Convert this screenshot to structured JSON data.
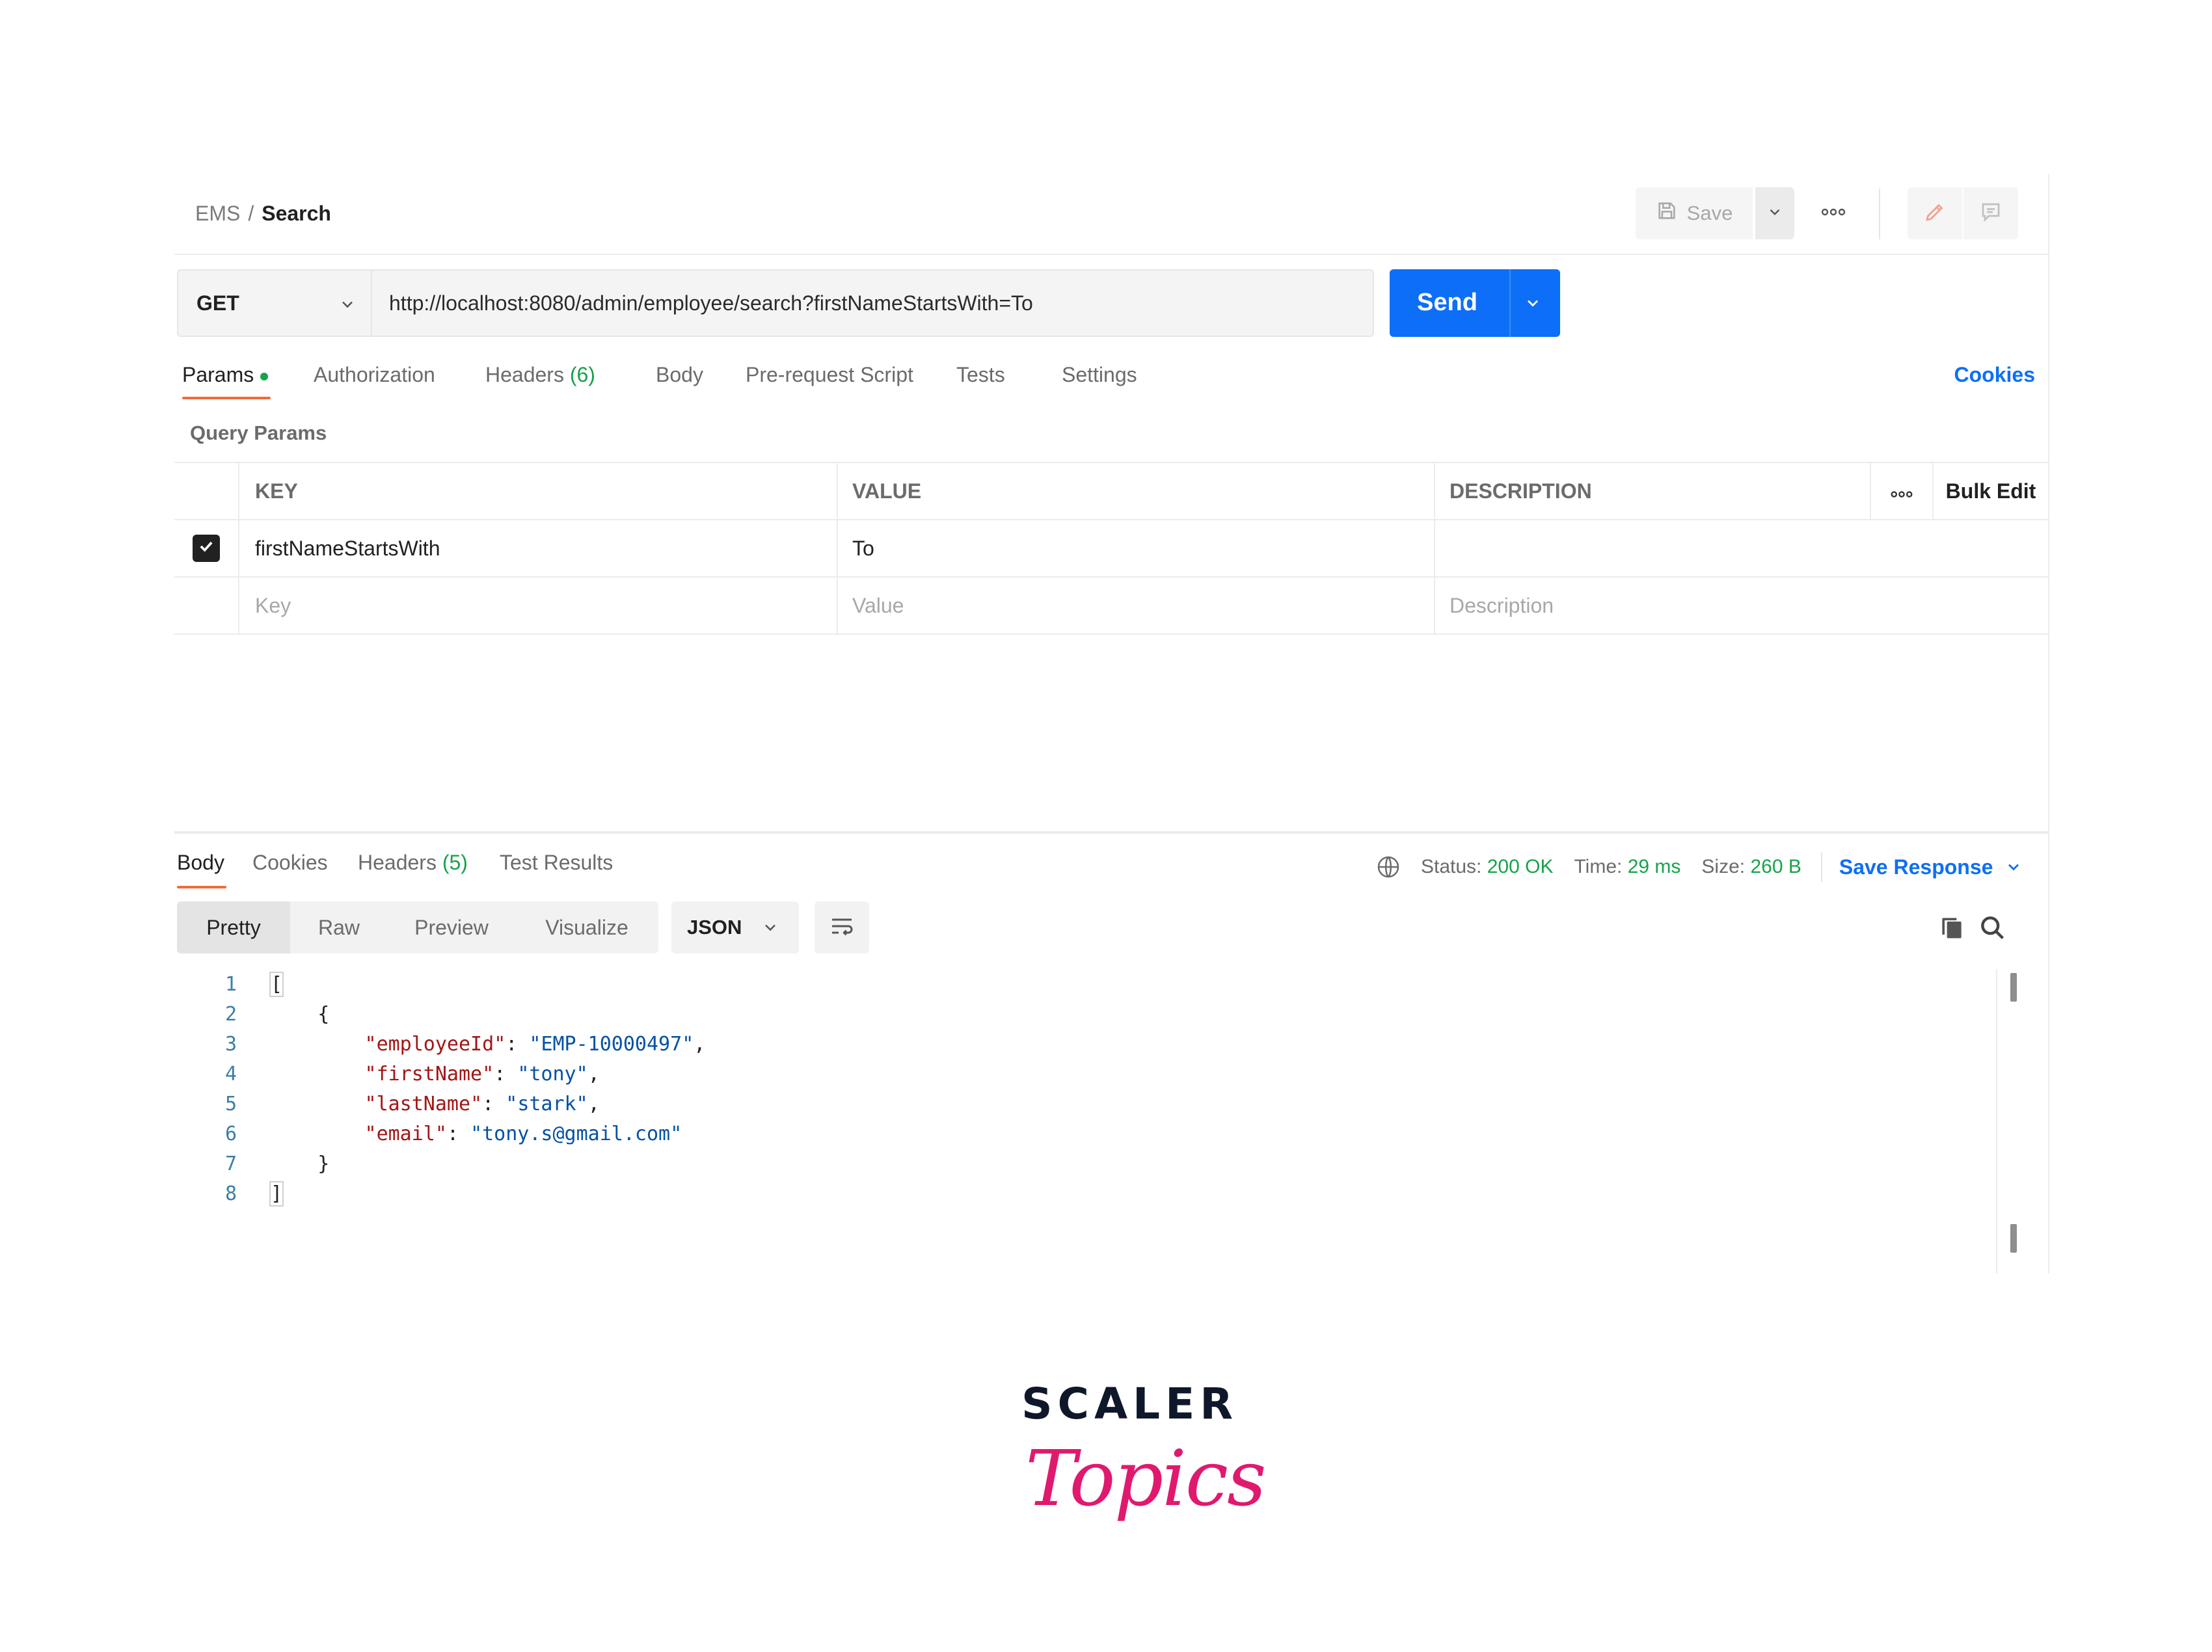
{
  "header": {
    "breadcrumb_parent": "EMS",
    "breadcrumb_sep": "/",
    "breadcrumb_current": "Search",
    "save_label": "Save"
  },
  "request": {
    "method": "GET",
    "url": "http://localhost:8080/admin/employee/search?firstNameStartsWith=To",
    "send_label": "Send"
  },
  "request_tabs": {
    "params": "Params",
    "authorization": "Authorization",
    "headers": "Headers",
    "headers_count": "(6)",
    "body": "Body",
    "prerequest": "Pre-request Script",
    "tests": "Tests",
    "settings": "Settings",
    "cookies": "Cookies"
  },
  "query_params": {
    "title": "Query Params",
    "columns": [
      "KEY",
      "VALUE",
      "DESCRIPTION"
    ],
    "bulk_edit": "Bulk Edit",
    "rows": [
      {
        "key": "firstNameStartsWith",
        "value": "To",
        "description": "",
        "checked": true
      }
    ],
    "placeholder": {
      "key": "Key",
      "value": "Value",
      "description": "Description"
    }
  },
  "response": {
    "tabs": {
      "body": "Body",
      "cookies": "Cookies",
      "headers": "Headers",
      "headers_count": "(5)",
      "test_results": "Test Results"
    },
    "status_label": "Status:",
    "status_value": "200 OK",
    "time_label": "Time:",
    "time_value": "29 ms",
    "size_label": "Size:",
    "size_value": "260 B",
    "save_response": "Save Response",
    "views": [
      "Pretty",
      "Raw",
      "Preview",
      "Visualize"
    ],
    "format": "JSON",
    "body_lines": [
      {
        "n": "1"
      },
      {
        "n": "2"
      },
      {
        "n": "3",
        "key": "employeeId",
        "value": "EMP-10000497"
      },
      {
        "n": "4",
        "key": "firstName",
        "value": "tony"
      },
      {
        "n": "5",
        "key": "lastName",
        "value": "stark"
      },
      {
        "n": "6",
        "key": "email",
        "value": "tony.s@gmail.com"
      },
      {
        "n": "7"
      },
      {
        "n": "8"
      }
    ]
  },
  "logo": {
    "top": "SCALER",
    "bottom": "Topics"
  },
  "colors": {
    "accent": "#0d6ff7",
    "tab_underline": "#f26b3a",
    "success": "#16a34a",
    "json_key": "#a31515",
    "json_string": "#0451a5",
    "logo_pink": "#e0196f"
  }
}
